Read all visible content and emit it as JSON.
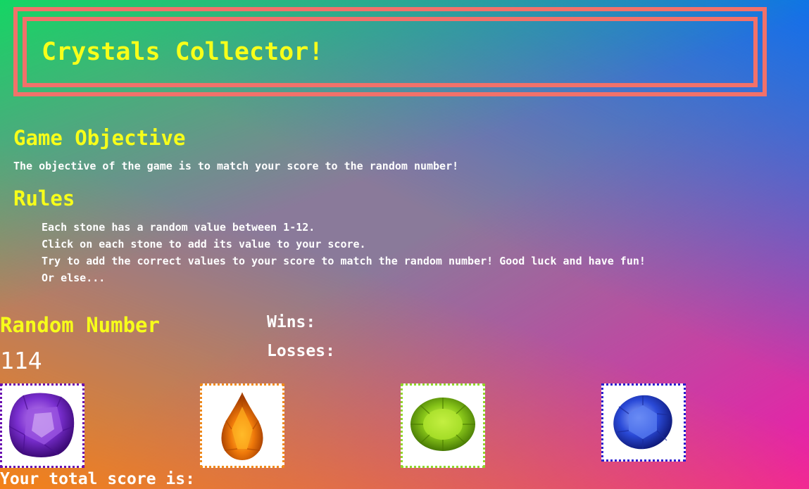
{
  "header": {
    "title": "Crystals Collector!"
  },
  "objective": {
    "heading": "Game Objective",
    "text": "The objective of the game is to match your score to the random number!"
  },
  "rules": {
    "heading": "Rules",
    "items": [
      "Each stone has a random value between 1-12.",
      "Click on each stone to add its value to your score.",
      "Try to add the correct values to your score to match the random number! Good luck and have fun!",
      "Or else..."
    ]
  },
  "game": {
    "random_label": "Random Number",
    "random_value": "114",
    "wins_label": "Wins:",
    "losses_label": "Losses:",
    "score_label": "Your total score is:"
  },
  "crystals": [
    {
      "name": "amethyst",
      "color": "#7a2fd0",
      "border": "#6a0fb0"
    },
    {
      "name": "citrine",
      "color": "#f07a0a",
      "border": "#f08a1a"
    },
    {
      "name": "peridot",
      "color": "#8ac81a",
      "border": "#8fd62a"
    },
    {
      "name": "sapphire",
      "color": "#2a4ad8",
      "border": "#2a1fd0"
    }
  ],
  "colors": {
    "accent_text": "#f7ff1a",
    "banner_border": "#f2716a"
  }
}
